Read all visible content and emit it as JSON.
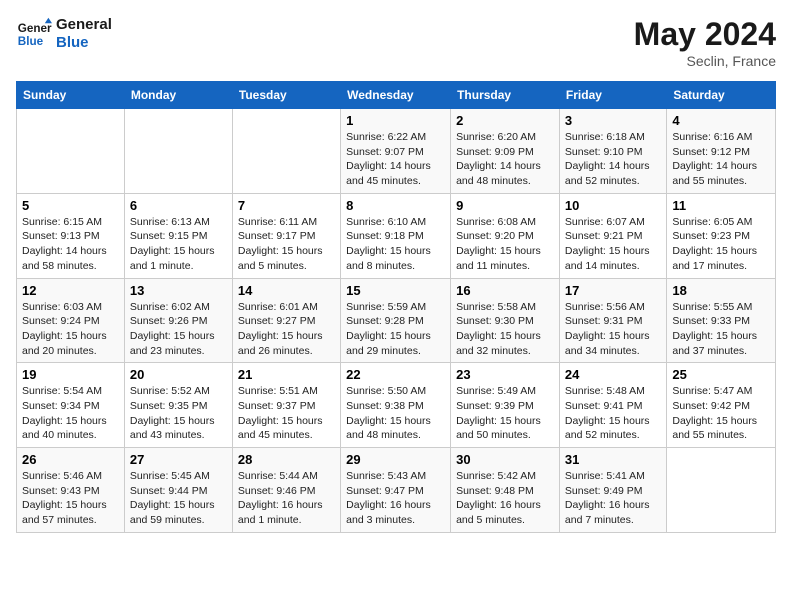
{
  "header": {
    "logo_line1": "General",
    "logo_line2": "Blue",
    "month_year": "May 2024",
    "location": "Seclin, France"
  },
  "weekdays": [
    "Sunday",
    "Monday",
    "Tuesday",
    "Wednesday",
    "Thursday",
    "Friday",
    "Saturday"
  ],
  "weeks": [
    [
      {
        "day": "",
        "sunrise": "",
        "sunset": "",
        "daylight": ""
      },
      {
        "day": "",
        "sunrise": "",
        "sunset": "",
        "daylight": ""
      },
      {
        "day": "",
        "sunrise": "",
        "sunset": "",
        "daylight": ""
      },
      {
        "day": "1",
        "sunrise": "Sunrise: 6:22 AM",
        "sunset": "Sunset: 9:07 PM",
        "daylight": "Daylight: 14 hours and 45 minutes."
      },
      {
        "day": "2",
        "sunrise": "Sunrise: 6:20 AM",
        "sunset": "Sunset: 9:09 PM",
        "daylight": "Daylight: 14 hours and 48 minutes."
      },
      {
        "day": "3",
        "sunrise": "Sunrise: 6:18 AM",
        "sunset": "Sunset: 9:10 PM",
        "daylight": "Daylight: 14 hours and 52 minutes."
      },
      {
        "day": "4",
        "sunrise": "Sunrise: 6:16 AM",
        "sunset": "Sunset: 9:12 PM",
        "daylight": "Daylight: 14 hours and 55 minutes."
      }
    ],
    [
      {
        "day": "5",
        "sunrise": "Sunrise: 6:15 AM",
        "sunset": "Sunset: 9:13 PM",
        "daylight": "Daylight: 14 hours and 58 minutes."
      },
      {
        "day": "6",
        "sunrise": "Sunrise: 6:13 AM",
        "sunset": "Sunset: 9:15 PM",
        "daylight": "Daylight: 15 hours and 1 minute."
      },
      {
        "day": "7",
        "sunrise": "Sunrise: 6:11 AM",
        "sunset": "Sunset: 9:17 PM",
        "daylight": "Daylight: 15 hours and 5 minutes."
      },
      {
        "day": "8",
        "sunrise": "Sunrise: 6:10 AM",
        "sunset": "Sunset: 9:18 PM",
        "daylight": "Daylight: 15 hours and 8 minutes."
      },
      {
        "day": "9",
        "sunrise": "Sunrise: 6:08 AM",
        "sunset": "Sunset: 9:20 PM",
        "daylight": "Daylight: 15 hours and 11 minutes."
      },
      {
        "day": "10",
        "sunrise": "Sunrise: 6:07 AM",
        "sunset": "Sunset: 9:21 PM",
        "daylight": "Daylight: 15 hours and 14 minutes."
      },
      {
        "day": "11",
        "sunrise": "Sunrise: 6:05 AM",
        "sunset": "Sunset: 9:23 PM",
        "daylight": "Daylight: 15 hours and 17 minutes."
      }
    ],
    [
      {
        "day": "12",
        "sunrise": "Sunrise: 6:03 AM",
        "sunset": "Sunset: 9:24 PM",
        "daylight": "Daylight: 15 hours and 20 minutes."
      },
      {
        "day": "13",
        "sunrise": "Sunrise: 6:02 AM",
        "sunset": "Sunset: 9:26 PM",
        "daylight": "Daylight: 15 hours and 23 minutes."
      },
      {
        "day": "14",
        "sunrise": "Sunrise: 6:01 AM",
        "sunset": "Sunset: 9:27 PM",
        "daylight": "Daylight: 15 hours and 26 minutes."
      },
      {
        "day": "15",
        "sunrise": "Sunrise: 5:59 AM",
        "sunset": "Sunset: 9:28 PM",
        "daylight": "Daylight: 15 hours and 29 minutes."
      },
      {
        "day": "16",
        "sunrise": "Sunrise: 5:58 AM",
        "sunset": "Sunset: 9:30 PM",
        "daylight": "Daylight: 15 hours and 32 minutes."
      },
      {
        "day": "17",
        "sunrise": "Sunrise: 5:56 AM",
        "sunset": "Sunset: 9:31 PM",
        "daylight": "Daylight: 15 hours and 34 minutes."
      },
      {
        "day": "18",
        "sunrise": "Sunrise: 5:55 AM",
        "sunset": "Sunset: 9:33 PM",
        "daylight": "Daylight: 15 hours and 37 minutes."
      }
    ],
    [
      {
        "day": "19",
        "sunrise": "Sunrise: 5:54 AM",
        "sunset": "Sunset: 9:34 PM",
        "daylight": "Daylight: 15 hours and 40 minutes."
      },
      {
        "day": "20",
        "sunrise": "Sunrise: 5:52 AM",
        "sunset": "Sunset: 9:35 PM",
        "daylight": "Daylight: 15 hours and 43 minutes."
      },
      {
        "day": "21",
        "sunrise": "Sunrise: 5:51 AM",
        "sunset": "Sunset: 9:37 PM",
        "daylight": "Daylight: 15 hours and 45 minutes."
      },
      {
        "day": "22",
        "sunrise": "Sunrise: 5:50 AM",
        "sunset": "Sunset: 9:38 PM",
        "daylight": "Daylight: 15 hours and 48 minutes."
      },
      {
        "day": "23",
        "sunrise": "Sunrise: 5:49 AM",
        "sunset": "Sunset: 9:39 PM",
        "daylight": "Daylight: 15 hours and 50 minutes."
      },
      {
        "day": "24",
        "sunrise": "Sunrise: 5:48 AM",
        "sunset": "Sunset: 9:41 PM",
        "daylight": "Daylight: 15 hours and 52 minutes."
      },
      {
        "day": "25",
        "sunrise": "Sunrise: 5:47 AM",
        "sunset": "Sunset: 9:42 PM",
        "daylight": "Daylight: 15 hours and 55 minutes."
      }
    ],
    [
      {
        "day": "26",
        "sunrise": "Sunrise: 5:46 AM",
        "sunset": "Sunset: 9:43 PM",
        "daylight": "Daylight: 15 hours and 57 minutes."
      },
      {
        "day": "27",
        "sunrise": "Sunrise: 5:45 AM",
        "sunset": "Sunset: 9:44 PM",
        "daylight": "Daylight: 15 hours and 59 minutes."
      },
      {
        "day": "28",
        "sunrise": "Sunrise: 5:44 AM",
        "sunset": "Sunset: 9:46 PM",
        "daylight": "Daylight: 16 hours and 1 minute."
      },
      {
        "day": "29",
        "sunrise": "Sunrise: 5:43 AM",
        "sunset": "Sunset: 9:47 PM",
        "daylight": "Daylight: 16 hours and 3 minutes."
      },
      {
        "day": "30",
        "sunrise": "Sunrise: 5:42 AM",
        "sunset": "Sunset: 9:48 PM",
        "daylight": "Daylight: 16 hours and 5 minutes."
      },
      {
        "day": "31",
        "sunrise": "Sunrise: 5:41 AM",
        "sunset": "Sunset: 9:49 PM",
        "daylight": "Daylight: 16 hours and 7 minutes."
      },
      {
        "day": "",
        "sunrise": "",
        "sunset": "",
        "daylight": ""
      }
    ]
  ]
}
